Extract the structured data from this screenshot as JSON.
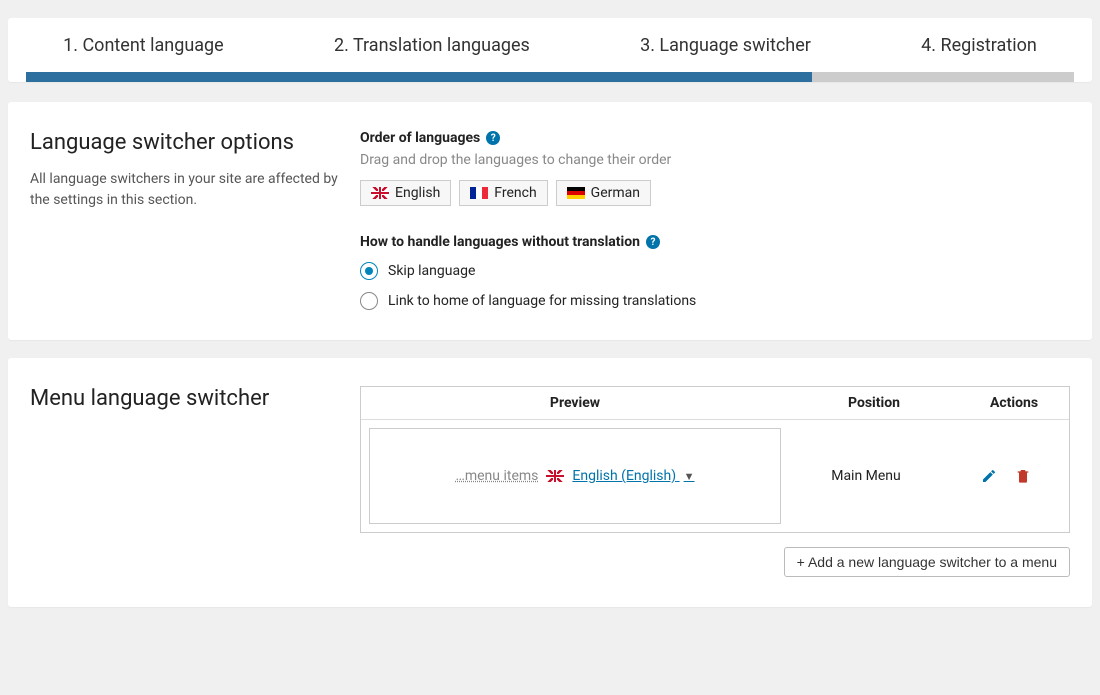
{
  "wizard": {
    "steps": [
      {
        "label": "1. Content language"
      },
      {
        "label": "2. Translation languages"
      },
      {
        "label": "3. Language switcher"
      },
      {
        "label": "4. Registration"
      }
    ],
    "progress_percent": 75
  },
  "switcher_options": {
    "heading": "Language switcher options",
    "description": "All language switchers in your site are affected by the settings in this section.",
    "order_label": "Order of languages",
    "order_hint": "Drag and drop the languages to change their order",
    "languages": [
      {
        "name": "English",
        "flag": "uk"
      },
      {
        "name": "French",
        "flag": "fr"
      },
      {
        "name": "German",
        "flag": "de"
      }
    ],
    "missing_label": "How to handle languages without translation",
    "missing_choices": [
      {
        "label": "Skip language",
        "selected": true
      },
      {
        "label": "Link to home of language for missing translations",
        "selected": false
      }
    ]
  },
  "menu_switcher": {
    "heading": "Menu language switcher",
    "columns": {
      "preview": "Preview",
      "position": "Position",
      "actions": "Actions"
    },
    "row": {
      "menu_items_text": "…menu items",
      "current_lang_label": "English (English)",
      "current_lang_flag": "uk",
      "position": "Main Menu"
    },
    "add_button": "+ Add a new language switcher to a menu"
  }
}
